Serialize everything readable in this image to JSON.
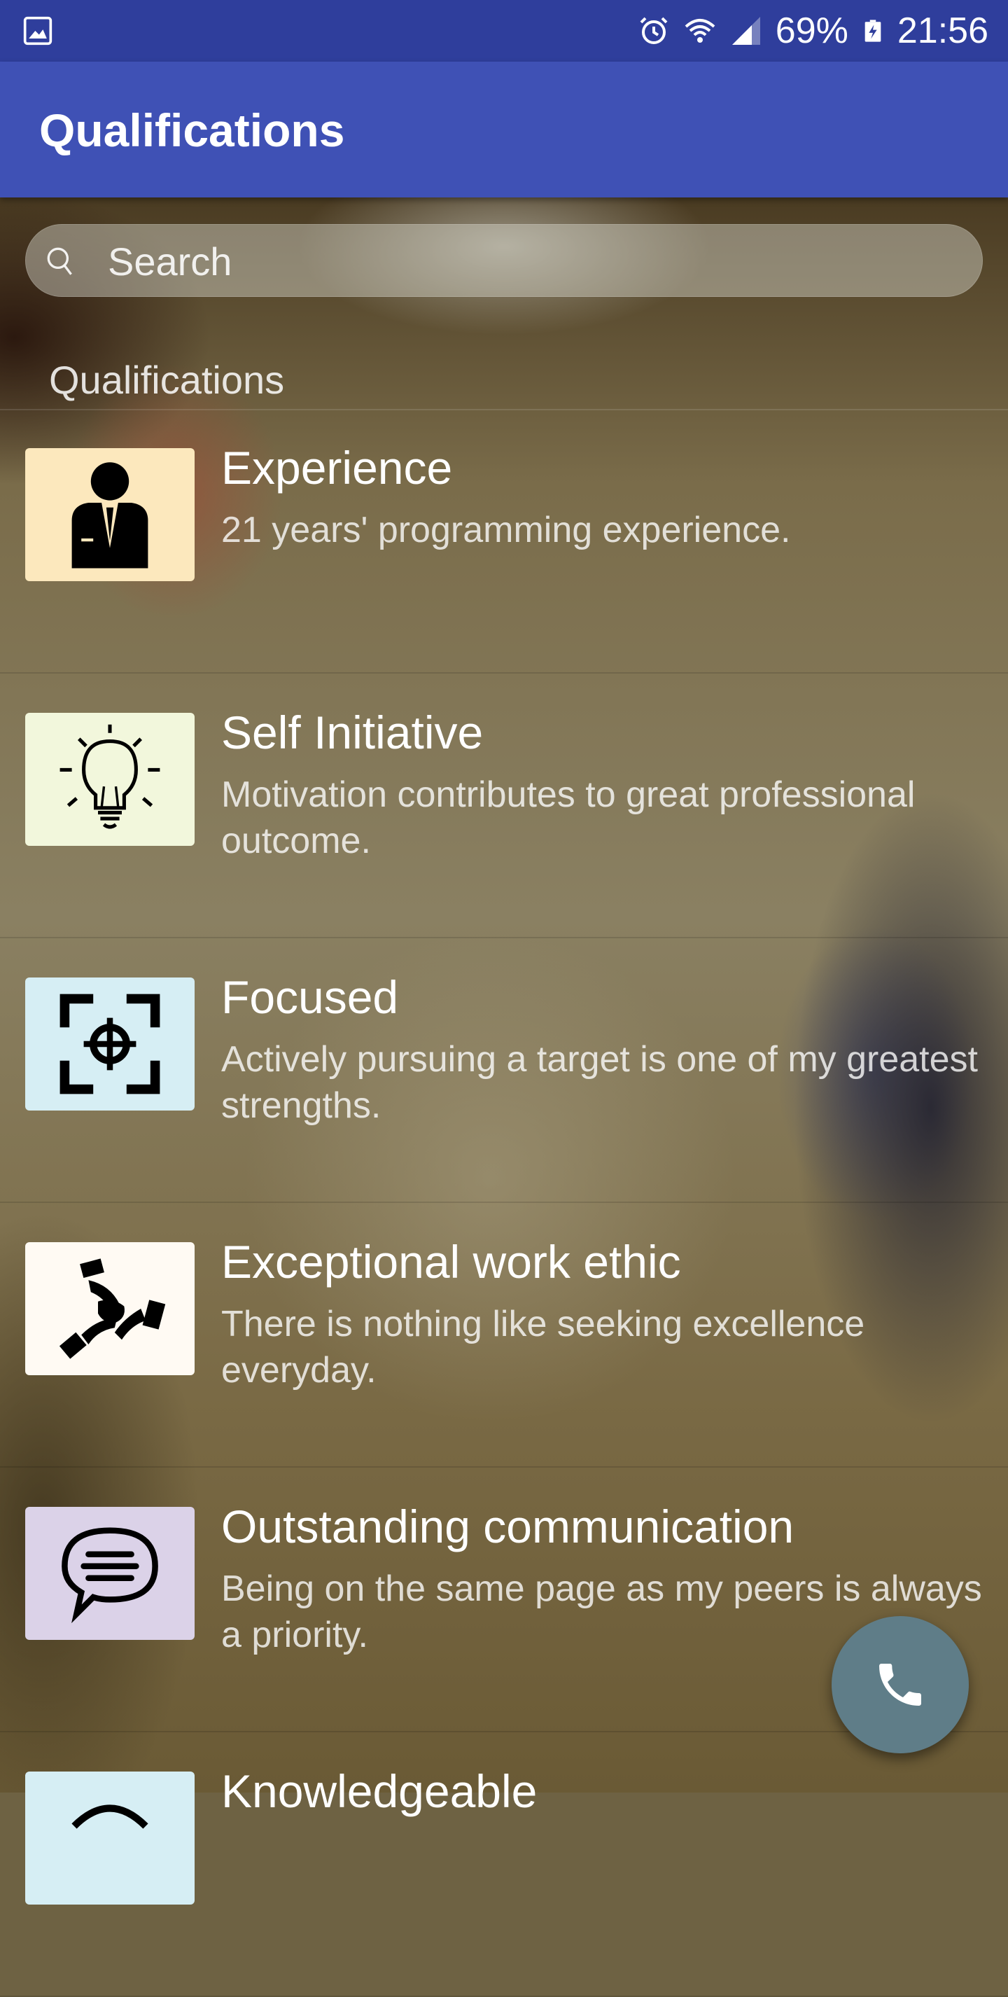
{
  "status_bar": {
    "battery": "69%",
    "time": "21:56",
    "icons": [
      "gallery-icon",
      "alarm-icon",
      "wifi-icon",
      "signal-icon",
      "battery-charging-icon"
    ]
  },
  "app_bar": {
    "title": "Qualifications"
  },
  "search": {
    "placeholder": "Search"
  },
  "section": {
    "header": "Qualifications"
  },
  "items": [
    {
      "title": "Experience",
      "description": "21 years' programming experience.",
      "icon": "businessman-icon",
      "thumb_color": "#fce8bd"
    },
    {
      "title": "Self Initiative",
      "description": "Motivation contributes to great professional outcome.",
      "icon": "lightbulb-icon",
      "thumb_color": "#f2f7dc"
    },
    {
      "title": "Focused",
      "description": "Actively pursuing a target is one of my greatest strengths.",
      "icon": "target-icon",
      "thumb_color": "#d6eef4"
    },
    {
      "title": "Exceptional work ethic",
      "description": "There is nothing like seeking excellence everyday.",
      "icon": "teamwork-hands-icon",
      "thumb_color": "#fffaf3"
    },
    {
      "title": "Outstanding communication",
      "description": "Being on the same page as my peers is always a priority.",
      "icon": "speech-bubble-icon",
      "thumb_color": "#dbd2e8"
    },
    {
      "title": "Knowledgeable",
      "description": "",
      "icon": "knowledge-icon",
      "thumb_color": "#d6eef4"
    }
  ],
  "fab": {
    "icon": "phone-icon"
  }
}
